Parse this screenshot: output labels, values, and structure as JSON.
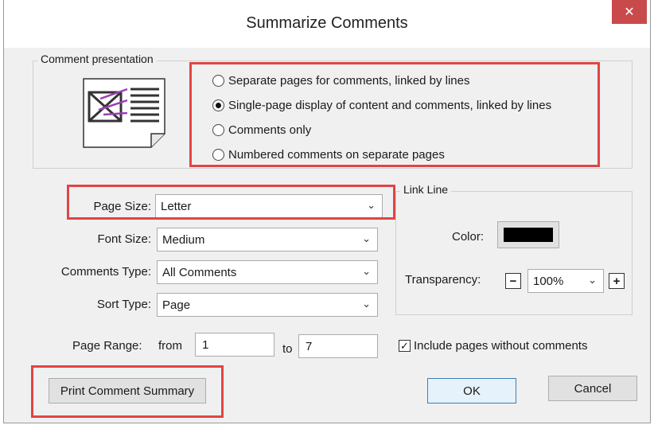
{
  "dialog": {
    "title": "Summarize Comments",
    "close_glyph": "✕"
  },
  "presentation": {
    "group_label": "Comment presentation",
    "options": [
      {
        "label": "Separate pages for comments, linked by lines",
        "checked": false
      },
      {
        "label": "Single-page display of content and comments, linked by lines",
        "checked": true
      },
      {
        "label": "Comments only",
        "checked": false
      },
      {
        "label": "Numbered comments on separate pages",
        "checked": false
      }
    ]
  },
  "fields": {
    "page_size": {
      "label": "Page Size:",
      "value": "Letter"
    },
    "font_size": {
      "label": "Font Size:",
      "value": "Medium"
    },
    "comments_type": {
      "label": "Comments Type:",
      "value": "All Comments"
    },
    "sort_type": {
      "label": "Sort Type:",
      "value": "Page"
    },
    "page_range": {
      "label": "Page Range:",
      "from_label": "from",
      "from": "1",
      "to_label": "to",
      "to": "7"
    }
  },
  "link_line": {
    "group_label": "Link Line",
    "color_label": "Color:",
    "color_value": "#000000",
    "transparency_label": "Transparency:",
    "transparency_value": "100%",
    "minus_glyph": "−",
    "plus_glyph": "+"
  },
  "include_pages": {
    "label": "Include pages without comments",
    "checked": true,
    "check_glyph": "✓"
  },
  "buttons": {
    "print": "Print Comment Summary",
    "ok": "OK",
    "cancel": "Cancel"
  },
  "chevron_glyph": "⌄",
  "colors": {
    "highlight": "#e04545",
    "close_bg": "#c94a4a",
    "accent": "#3c7fb1",
    "preview_ink": "#9b3fb5"
  }
}
